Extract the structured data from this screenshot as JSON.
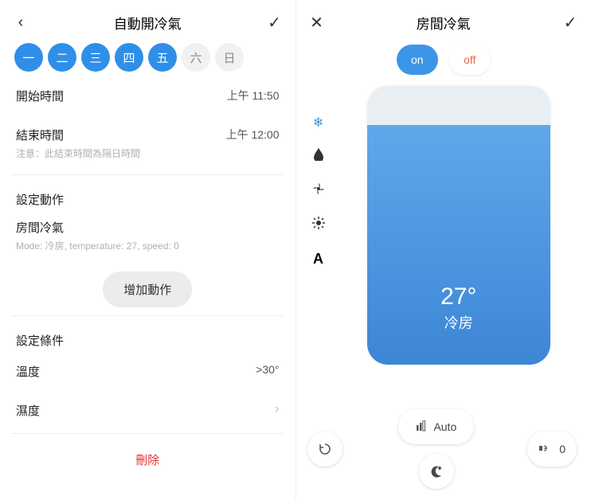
{
  "left": {
    "title": "自動開冷氣",
    "days": [
      {
        "l": "一",
        "on": true
      },
      {
        "l": "二",
        "on": true
      },
      {
        "l": "三",
        "on": true
      },
      {
        "l": "四",
        "on": true
      },
      {
        "l": "五",
        "on": true
      },
      {
        "l": "六",
        "on": false
      },
      {
        "l": "日",
        "on": false
      }
    ],
    "start": {
      "label": "開始時間",
      "value": "上午 11:50"
    },
    "end": {
      "label": "結束時間",
      "sub": "注意：此結束時間為隔日時間",
      "value": "上午 12:00"
    },
    "actions_title": "設定動作",
    "device": {
      "name": "房間冷氣",
      "desc": "Mode: 冷房, temperature: 27, speed: 0"
    },
    "add_action": "增加動作",
    "cond_title": "設定條件",
    "temp": {
      "label": "溫度",
      "value": ">30°"
    },
    "humidity": {
      "label": "濕度"
    },
    "delete": "刪除"
  },
  "right": {
    "title": "房間冷氣",
    "on": "on",
    "off": "off",
    "temp": "27°",
    "mode": "冷房",
    "fan": "Auto",
    "swing": "0",
    "icons": {
      "snow": "❄",
      "drop": "💧",
      "fan": "✦",
      "sun": "☀",
      "auto": "A",
      "bars": "▮▯",
      "moon": "☾",
      "refresh": "⟳",
      "wind": "≋"
    }
  }
}
